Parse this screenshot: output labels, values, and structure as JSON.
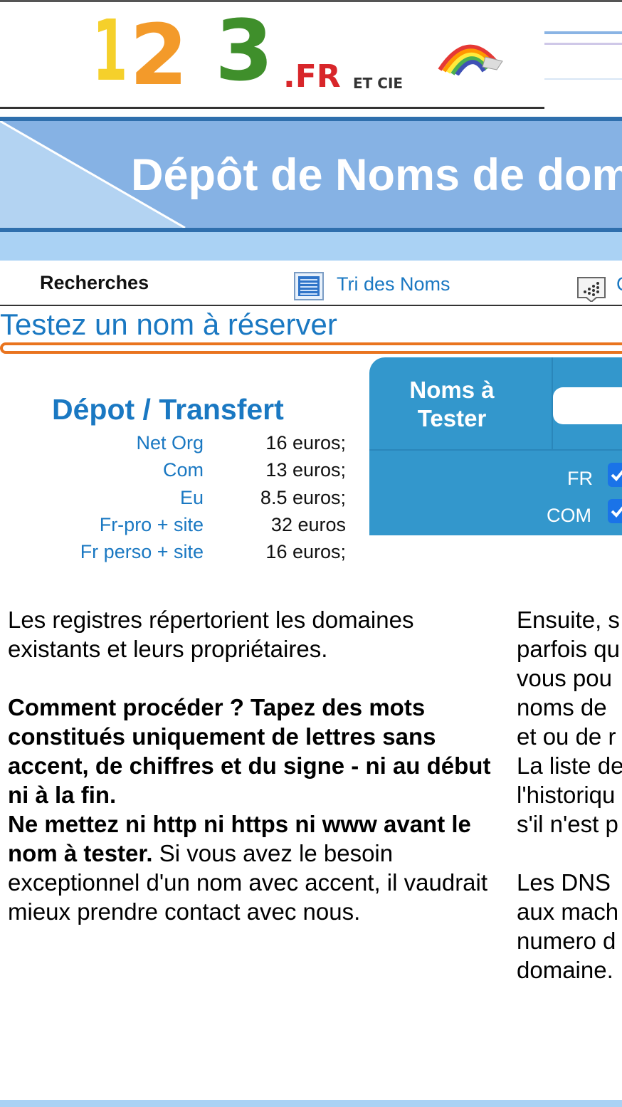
{
  "logo": {
    "digit1": "1",
    "digit2": "2",
    "digit3": "3",
    "suffix": ".FR",
    "etcie": "ET CIE"
  },
  "banner": {
    "title": "Dépôt de Noms de domaine"
  },
  "nav": {
    "recherches": "Recherches",
    "tri": "Tri des Noms",
    "third": "C"
  },
  "test": {
    "heading": "Testez un nom à réserver"
  },
  "pricing": {
    "title": "Dépot / Transfert",
    "rows": [
      {
        "name": "Net Org",
        "price": "16 euros;"
      },
      {
        "name": "Com",
        "price": "13 euros;"
      },
      {
        "name": "Eu",
        "price": "8.5 euros;"
      },
      {
        "name": "Fr-pro + site",
        "price": "32 euros"
      },
      {
        "name": "Fr perso + site",
        "price": "16 euros;"
      }
    ]
  },
  "panel": {
    "label_line1": "Noms à",
    "label_line2": "Tester",
    "input_value": "",
    "extensions": [
      {
        "label": "FR",
        "checked": true
      },
      {
        "label": "COM",
        "checked": true
      }
    ]
  },
  "left_column": {
    "p1": "Les registres répertorient les domaines existants et leurs propriétaires.",
    "bold1": "Comment procéder ? Tapez des mots constitués uniquement de lettres sans accent, de chiffres et du signe - ni au début ni à la fin.",
    "bold2": "Ne mettez ni http ni https ni www avant le nom à tester.",
    "p2_rest": " Si vous avez le besoin exceptionnel d'un nom avec accent, il vaudrait mieux prendre contact avec nous."
  },
  "right_column": {
    "lines1": [
      "Ensuite, s",
      "parfois qu",
      "vous pou",
      "noms de",
      "et ou de r",
      "La liste de",
      "l'historiqu",
      "s'il n'est p"
    ],
    "lines2": [
      "Les DNS",
      "aux mach",
      "numero d",
      "domaine."
    ]
  },
  "colors": {
    "link_blue": "#1a78c2",
    "banner_blue": "#86b2e4",
    "panel_blue": "#3397cc",
    "accent_orange": "#e9741f"
  }
}
